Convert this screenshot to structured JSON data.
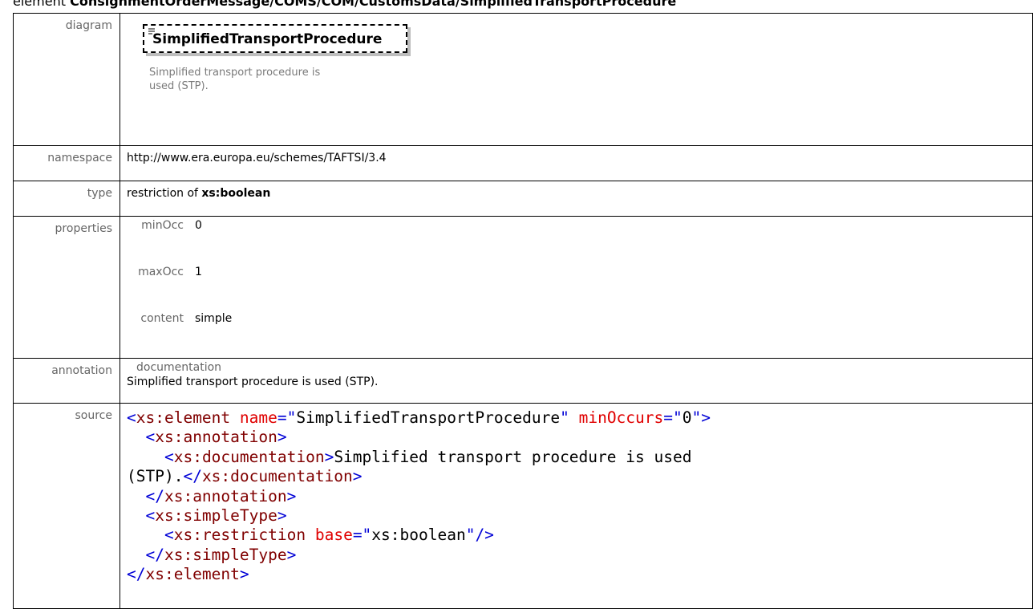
{
  "header": {
    "kind": "element",
    "path": "ConsignmentOrderMessage/COMS/COM/CustomsData/SimplifiedTransportProcedure"
  },
  "labels": {
    "diagram": "diagram",
    "namespace": "namespace",
    "type": "type",
    "properties": "properties",
    "annotation": "annotation",
    "source": "source"
  },
  "diagram": {
    "element_name": "SimplifiedTransportProcedure",
    "description": "Simplified transport procedure is used (STP)."
  },
  "namespace": "http://www.era.europa.eu/schemes/TAFTSI/3.4",
  "type": {
    "prefix": "restriction of ",
    "base": "xs:boolean"
  },
  "properties": [
    {
      "key": "minOcc",
      "value": "0"
    },
    {
      "key": "maxOcc",
      "value": "1"
    },
    {
      "key": "content",
      "value": "simple"
    }
  ],
  "annotation": {
    "key": "documentation",
    "value": "Simplified transport procedure is used (STP)."
  },
  "source": {
    "element_name_attr": "name",
    "element_name_value": "SimplifiedTransportProcedure",
    "min_occurs_attr": "minOccurs",
    "min_occurs_value": "0",
    "doc_text_line1": "Simplified transport procedure is used",
    "doc_text_line2": "(STP).",
    "restriction_base_attr": "base",
    "restriction_base_value": "xs:boolean"
  },
  "colors": {
    "tag": "#0000d6",
    "tag_name": "#800000",
    "attr_name": "#e00000"
  }
}
